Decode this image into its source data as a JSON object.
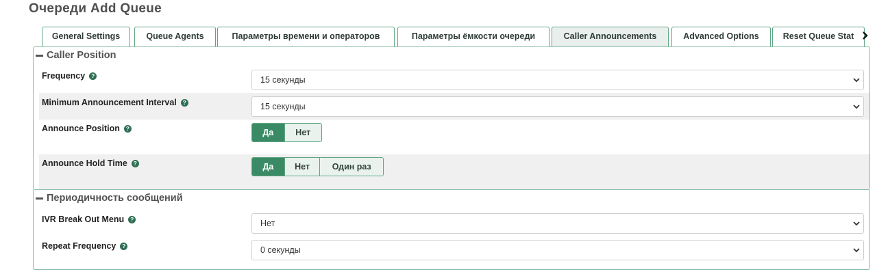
{
  "page": {
    "title": "Очереди Add Queue"
  },
  "tabs": [
    {
      "label": "General Settings"
    },
    {
      "label": "Queue Agents"
    },
    {
      "label": "Параметры времени и операторов"
    },
    {
      "label": "Параметры ёмкости очереди"
    },
    {
      "label": "Caller Announcements",
      "active": true
    },
    {
      "label": "Advanced Options"
    },
    {
      "label": "Reset Queue Stat"
    }
  ],
  "sections": {
    "caller_position": {
      "title": "Caller Position",
      "frequency": {
        "label": "Frequency",
        "value": "15 секунды"
      },
      "min_interval": {
        "label": "Minimum Announcement Interval",
        "value": "15 секунды"
      },
      "announce_position": {
        "label": "Announce Position",
        "options": [
          "Да",
          "Нет"
        ],
        "selected": "Да"
      },
      "announce_hold_time": {
        "label": "Announce Hold Time",
        "options": [
          "Да",
          "Нет",
          "Один раз"
        ],
        "selected": "Да"
      }
    },
    "periodic": {
      "title": "Периодичность сообщений",
      "ivr_breakout": {
        "label": "IVR Break Out Menu",
        "value": "Нет"
      },
      "repeat_frequency": {
        "label": "Repeat Frequency",
        "value": "0 секунды"
      }
    }
  },
  "icons": {
    "help": "question-circle-icon",
    "dropdown": "chevron-down-icon",
    "tab_scroll": "chevron-right-icon",
    "collapse": "minus-icon"
  },
  "colors": {
    "accent": "#3a8a65",
    "border": "#5fa583",
    "active_tab": "#e8efec"
  }
}
